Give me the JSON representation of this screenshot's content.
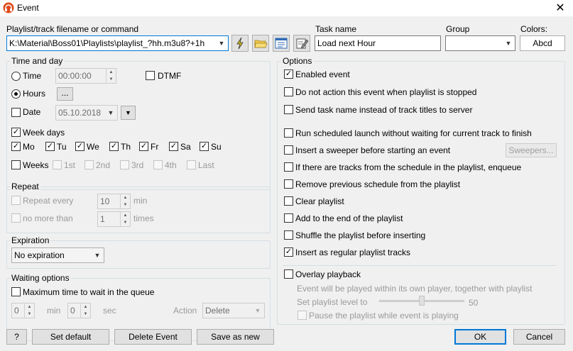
{
  "window": {
    "title": "Event",
    "close_glyph": "✕",
    "icon": "app-headphones-icon"
  },
  "top": {
    "command_label": "Playlist/track filename or command",
    "command_value": "K:\\Material\\Boss01\\Playlists\\playlist_?hh.m3u8?+1h",
    "task_label": "Task name",
    "task_value": "Load next Hour",
    "group_label": "Group",
    "group_value": "",
    "colors_label": "Colors:",
    "colors_button": "Abcd",
    "tool_icons": [
      "lightning-icon",
      "folder-open-icon",
      "list-window-icon",
      "edit-note-icon"
    ]
  },
  "time_and_day": {
    "title": "Time and day",
    "time_label": "Time",
    "time_value": "00:00:00",
    "dtmf_label": "DTMF",
    "hours_label": "Hours",
    "hours_button": "...",
    "date_label": "Date",
    "date_value": "05.10.2018",
    "week_days_label": "Week days",
    "days": [
      {
        "label": "Mo",
        "checked": true
      },
      {
        "label": "Tu",
        "checked": true
      },
      {
        "label": "We",
        "checked": true
      },
      {
        "label": "Th",
        "checked": true
      },
      {
        "label": "Fr",
        "checked": true
      },
      {
        "label": "Sa",
        "checked": true
      },
      {
        "label": "Su",
        "checked": true
      }
    ],
    "weeks_label": "Weeks",
    "weeks": [
      "1st",
      "2nd",
      "3rd",
      "4th",
      "Last"
    ]
  },
  "repeat": {
    "title": "Repeat",
    "repeat_every_label": "Repeat every",
    "repeat_every_value": "10",
    "repeat_every_unit": "min",
    "no_more_than_label": "no more than",
    "no_more_than_value": "1",
    "no_more_than_unit": "times"
  },
  "expiration": {
    "title": "Expiration",
    "value": "No expiration"
  },
  "waiting": {
    "title": "Waiting options",
    "max_time_label": "Maximum time to wait in the queue",
    "min_value": "0",
    "min_unit": "min",
    "sec_value": "0",
    "sec_unit": "sec",
    "action_label": "Action",
    "action_value": "Delete"
  },
  "options": {
    "title": "Options",
    "items": [
      {
        "label": "Enabled event",
        "checked": true
      },
      {
        "label": "Do not action this event when playlist is stopped",
        "checked": false
      },
      {
        "label": "Send task name instead of track titles to server",
        "checked": false
      },
      {
        "label": "Run scheduled launch without waiting for current track to finish",
        "checked": false
      },
      {
        "label": "Insert a sweeper before starting an event",
        "checked": false
      },
      {
        "label": "If there are tracks from the schedule in the playlist, enqueue",
        "checked": false
      },
      {
        "label": "Remove previous schedule from the playlist",
        "checked": false
      },
      {
        "label": "Clear playlist",
        "checked": false
      },
      {
        "label": "Add to the end of the playlist",
        "checked": false
      },
      {
        "label": "Shuffle the playlist before inserting",
        "checked": false
      },
      {
        "label": "Insert as regular playlist tracks",
        "checked": true
      }
    ],
    "sweepers_button": "Sweepers...",
    "overlay_label": "Overlay playback",
    "overlay_desc": "Event will be played within its own player, together with playlist",
    "playlist_level_label": "Set playlist level to",
    "playlist_level_value": "50",
    "playlist_level_fraction": 0.5,
    "pause_label": "Pause the playlist while event is playing"
  },
  "footer": {
    "help": "?",
    "set_default": "Set default",
    "delete_event": "Delete Event",
    "save_as_new": "Save as new",
    "ok": "OK",
    "cancel": "Cancel"
  },
  "check_glyph": "✓"
}
